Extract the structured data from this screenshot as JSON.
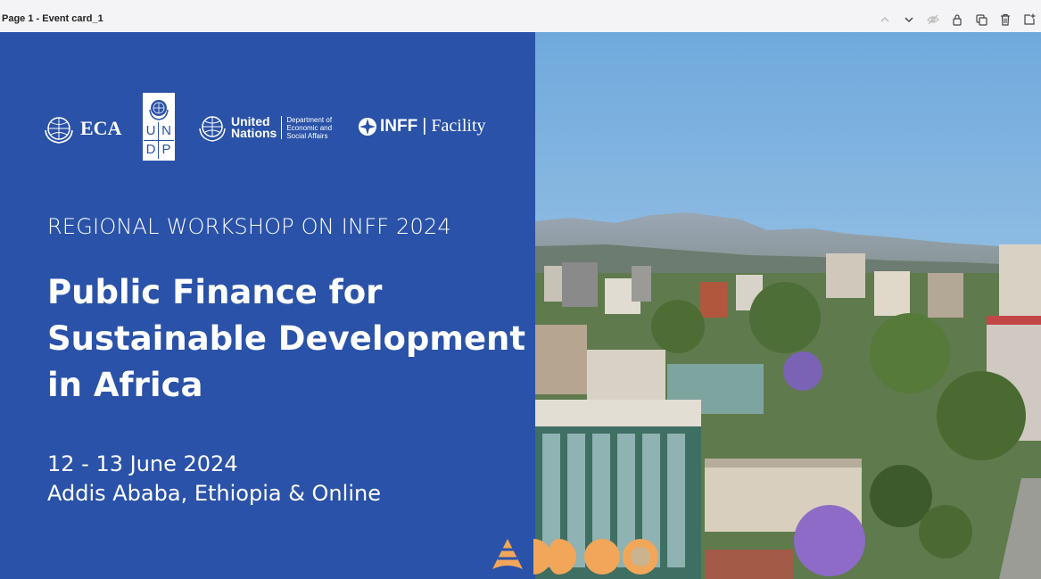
{
  "toolbar": {
    "page_title": "Page 1 - Event card_1",
    "icons": [
      "chevron-up-icon",
      "chevron-down-icon",
      "eye-off-icon",
      "lock-icon",
      "duplicate-icon",
      "trash-icon",
      "add-page-icon"
    ]
  },
  "card": {
    "logos": {
      "eca": "ECA",
      "undp_letters": [
        "U",
        "N",
        "D",
        "P"
      ],
      "un_line1": "United",
      "un_line2": "Nations",
      "desa_line1": "Department of",
      "desa_line2": "Economic and",
      "desa_line3": "Social Affairs",
      "inff": "INFF",
      "inff_sep": "|",
      "facility": "Facility"
    },
    "eyebrow": "REGIONAL WORKSHOP ON INFF 2024",
    "headline_line1": "Public Finance for",
    "headline_line2": "Sustainable Development",
    "headline_line3": "in Africa",
    "dates": "12 - 13 June 2024",
    "location": "Addis Ababa, Ethiopia & Online"
  },
  "colors": {
    "panel_blue": "#2a52a8",
    "accent_orange": "#f2a65a",
    "text_white": "#ffffff"
  }
}
